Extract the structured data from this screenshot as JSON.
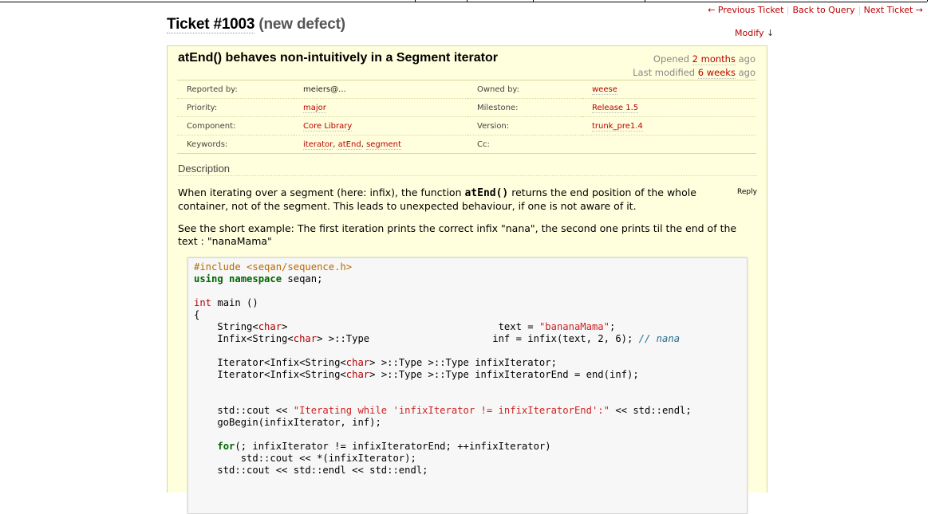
{
  "nav": {
    "prev": "← Previous Ticket",
    "back": "Back to Query",
    "next": "Next Ticket →"
  },
  "ticket": {
    "number": "Ticket #1003",
    "status": "(new defect)",
    "modify": "Modify",
    "modify_arrow": "↓",
    "summary": "atEnd() behaves non-intuitively in a Segment iterator",
    "opened_prefix": "Opened",
    "opened_link": "2 months",
    "opened_suffix": "ago",
    "modified_prefix": "Last modified",
    "modified_link": "6 weeks",
    "modified_suffix": "ago"
  },
  "properties": {
    "reported_by_label": "Reported by:",
    "reported_by": "meiers@...",
    "owned_by_label": "Owned by:",
    "owned_by": "weese",
    "priority_label": "Priority:",
    "priority": "major",
    "milestone_label": "Milestone:",
    "milestone": "Release 1.5",
    "component_label": "Component:",
    "component": "Core Library",
    "version_label": "Version:",
    "version": "trunk_pre1.4",
    "keywords_label": "Keywords:",
    "keyword_1": "iterator",
    "keyword_2": "atEnd",
    "keyword_3": "segment",
    "keyword_sep": ",",
    "cc_label": "Cc:"
  },
  "description": {
    "heading": "Description",
    "reply": "Reply",
    "p1_before": "When iterating over a segment (here: infix), the function ",
    "p1_code": "atEnd()",
    "p1_after": " returns the end position of the whole container, not of the segment. This leads to unexpected behaviour, if one is not aware of it.",
    "p2": "See the short example: The first iteration prints the correct infix \"nana\", the second one prints til the end of the text : \"nanaMama\""
  },
  "code": {
    "l1": "#include <seqan/sequence.h>",
    "l2_kw1": "using",
    "l2_kw2": "namespace",
    "l2_rest": " seqan;",
    "l4_ty": "int",
    "l4_rest": " main ()",
    "l5": "{",
    "l6_a": "    String<",
    "l6_ty": "char",
    "l6_b": ">                                    text = ",
    "l6_str": "\"bananaMama\"",
    "l6_c": ";",
    "l7_a": "    Infix<String<",
    "l7_ty": "char",
    "l7_b": "> >::Type                     inf = infix(text, 2, 6); ",
    "l7_cm": "// nana",
    "l9_a": "    Iterator<Infix<String<",
    "l9_ty": "char",
    "l9_b": "> >::Type >::Type infixIterator;",
    "l10_a": "    Iterator<Infix<String<",
    "l10_ty": "char",
    "l10_b": "> >::Type >::Type infixIteratorEnd = end(inf);",
    "l13_a": "    std::cout << ",
    "l13_str": "\"Iterating while 'infixIterator != infixIteratorEnd':\"",
    "l13_b": " << std::endl;",
    "l14": "    goBegin(infixIterator, inf);",
    "l16_kw": "for",
    "l16_b": "(; infixIterator != infixIteratorEnd; ++infixIterator)",
    "l17": "        std::cout << *(infixIterator);",
    "l18": "    std::cout << std::endl << std::endl;"
  },
  "colors": {
    "link": "#bb0000",
    "ticket_bg": "#ffffdd",
    "code_bg": "#f7f7f7"
  }
}
